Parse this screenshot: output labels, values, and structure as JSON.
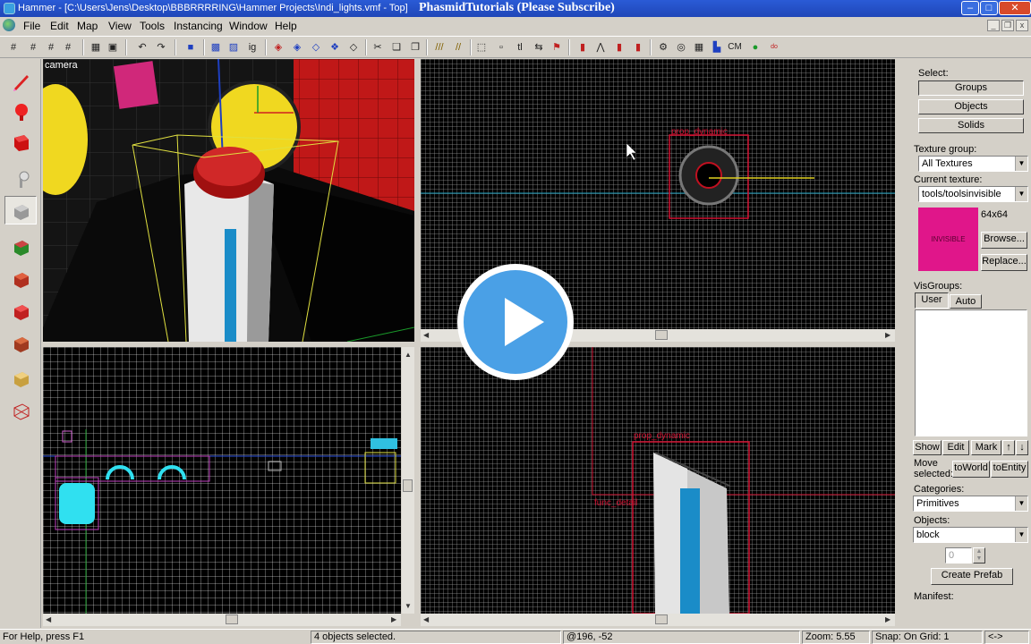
{
  "window": {
    "title": "Hammer - [C:\\Users\\Jens\\Desktop\\BBBRRRRING\\Hammer Projects\\Indi_lights.vmf - Top]",
    "overlay_title": "PhasmidTutorials (Please Subscribe)"
  },
  "menu": [
    "File",
    "Edit",
    "Map",
    "View",
    "Tools",
    "Instancing",
    "Window",
    "Help"
  ],
  "viewports": {
    "camera_label": "camera",
    "top_entity_label": "prop_dynamic",
    "side_entity_label": "prop_dynamic",
    "side_brush_label": "func_detail"
  },
  "right_panel": {
    "select_label": "Select:",
    "select_buttons": [
      "Groups",
      "Objects",
      "Solids"
    ],
    "texture_group_label": "Texture group:",
    "texture_group_value": "All Textures",
    "current_texture_label": "Current texture:",
    "current_texture_value": "tools/toolsinvisible",
    "texture_size": "64x64",
    "texture_preview_text": "INVISIBLE",
    "texture_preview_color": "#e0168a",
    "browse_button": "Browse...",
    "replace_button": "Replace...",
    "visgroups_label": "VisGroups:",
    "visgroup_tabs": [
      "User",
      "Auto"
    ],
    "visgroup_buttons": [
      "Show",
      "Edit",
      "Mark"
    ],
    "move_selected_label": "Move selected:",
    "to_world_button": "toWorld",
    "to_entity_button": "toEntity",
    "categories_label": "Categories:",
    "categories_value": "Primitives",
    "objects_label": "Objects:",
    "objects_value": "block",
    "faces_value": "0",
    "create_prefab_button": "Create Prefab",
    "manifest_label": "Manifest:"
  },
  "status_bar": {
    "help": "For Help, press F1",
    "selection": "4 objects selected.",
    "coords": "@196, -52",
    "zoom": "Zoom: 5.55",
    "snap": "Snap: On Grid: 1",
    "arrows": "<->"
  },
  "colors": {
    "title_bar": "#2a5bd6",
    "selection_red": "#d01030",
    "prefab_cyan": "#30e0f0",
    "viewport_bg": "#000000",
    "play_button": "#4aa0e6"
  },
  "icons": {
    "play": "play-icon",
    "app": "hammer-app-icon"
  }
}
